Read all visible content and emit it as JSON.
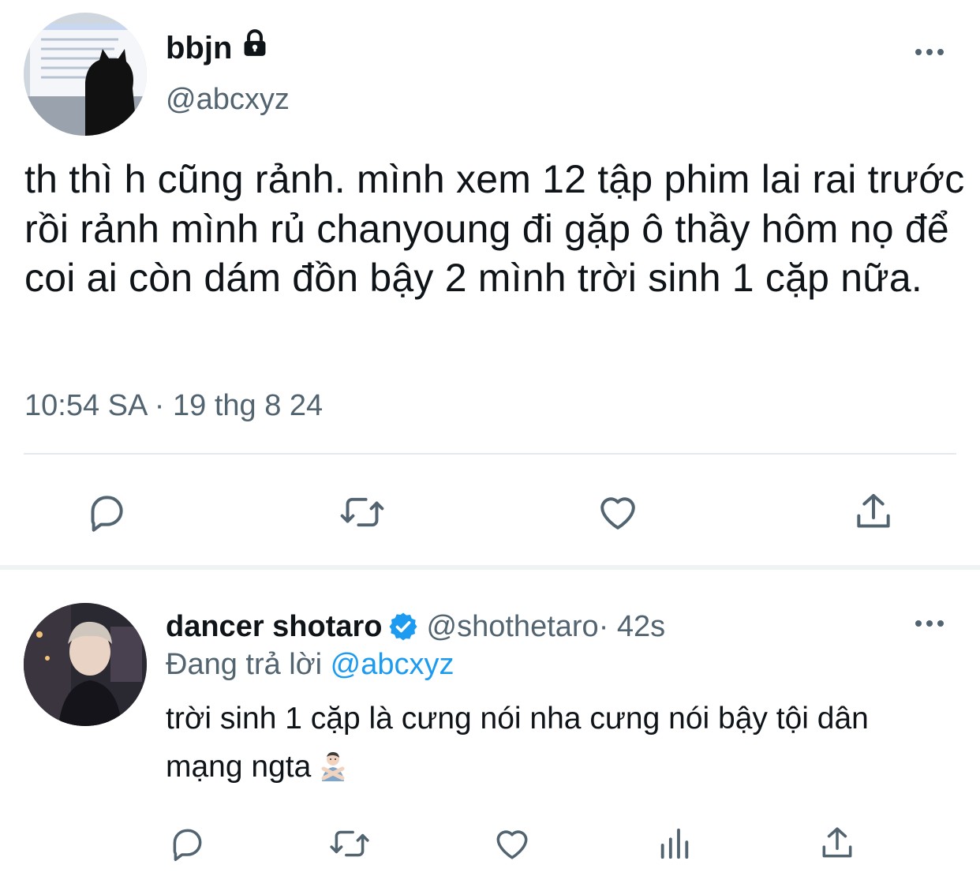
{
  "tweet": {
    "display_name": "bbjn",
    "handle": "@abcxyz",
    "text": "th thì h cũng rảnh. mình xem 12 tập phim lai rai trước rồi rảnh mình rủ chanyoung đi gặp ô thầy hôm nọ để coi ai còn dám đồn bậy 2 mình trời sinh 1 cặp nữa.",
    "timestamp": "10:54 SA · 19 thg 8 24",
    "protected_icon": "lock-icon",
    "actions": [
      "reply-icon",
      "retweet-icon",
      "like-icon",
      "share-icon"
    ]
  },
  "reply": {
    "display_name": "dancer shotaro",
    "handle": "@shothetaro",
    "time": " · 42s",
    "replying_prefix": "Đang trả lời ",
    "replying_to": "@abcxyz",
    "text": "trời sinh 1 cặp là cưng nói nha cưng nói bậy tội dân mạng ngta",
    "emoji_icon": "person-gesturing-no-icon",
    "verified_icon": "verified-badge-icon",
    "actions": [
      "reply-icon",
      "retweet-icon",
      "like-icon",
      "analytics-icon",
      "share-icon"
    ]
  },
  "colors": {
    "text": "#0f1419",
    "secondary": "#536471",
    "accent": "#1d9bf0",
    "divider": "#e6e9eb"
  }
}
